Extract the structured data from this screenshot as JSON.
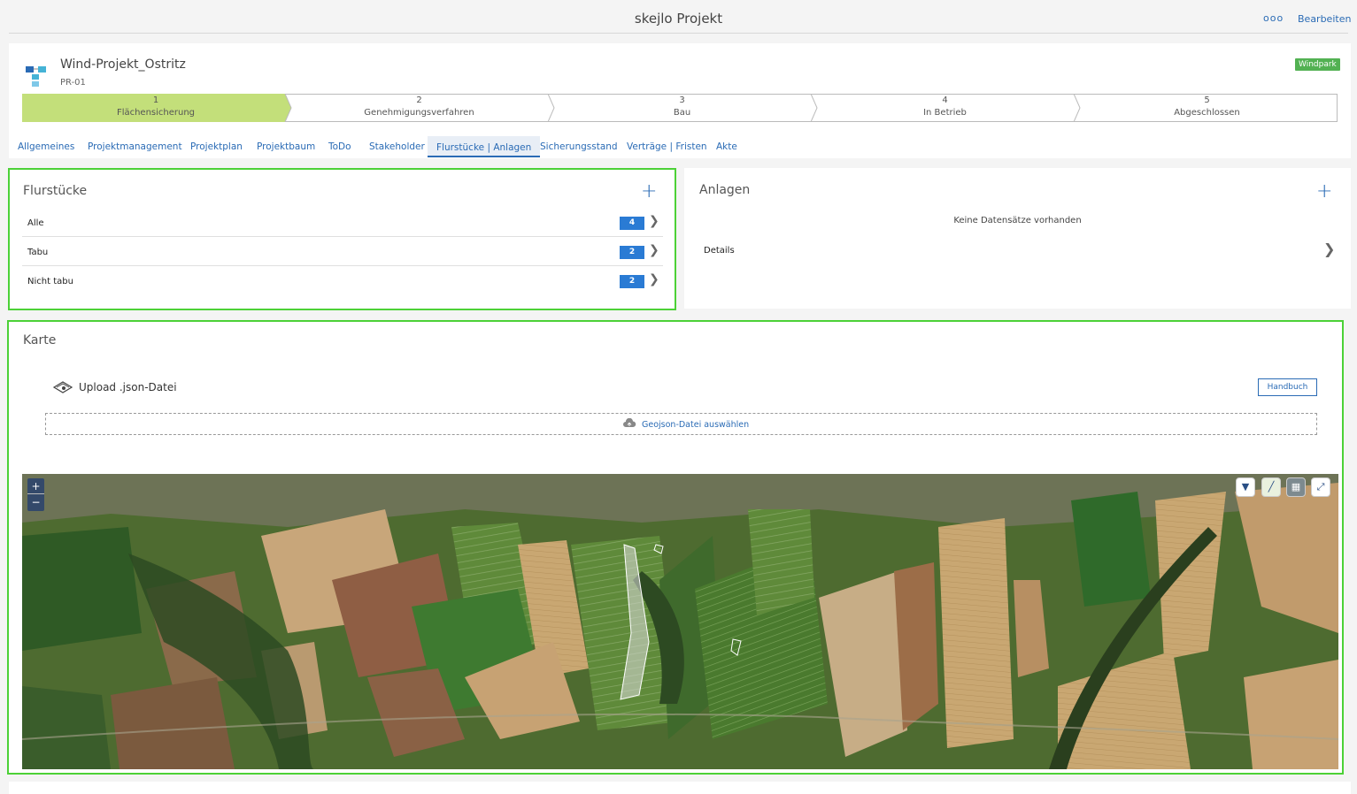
{
  "topbar": {
    "title": "skejlo Projekt",
    "more_label": "ooo",
    "edit_label": "Bearbeiten"
  },
  "project": {
    "name": "Wind-Projekt_Ostritz",
    "id": "PR-01",
    "badge": "Windpark",
    "badge_color": "#52b152"
  },
  "stepper": {
    "active_color": "#c3df7a",
    "steps": [
      {
        "num": "1",
        "label": "Flächensicherung"
      },
      {
        "num": "2",
        "label": "Genehmigungsverfahren"
      },
      {
        "num": "3",
        "label": "Bau"
      },
      {
        "num": "4",
        "label": "In Betrieb"
      },
      {
        "num": "5",
        "label": "Abgeschlossen"
      }
    ]
  },
  "tabs": [
    {
      "label": "Allgemeines"
    },
    {
      "label": "Projektmanagement"
    },
    {
      "label": "Projektplan"
    },
    {
      "label": "Projektbaum"
    },
    {
      "label": "ToDo"
    },
    {
      "label": "Stakeholder"
    },
    {
      "label": "Flurstücke | Anlagen",
      "active": true
    },
    {
      "label": "Sicherungsstand"
    },
    {
      "label": "Verträge | Fristen"
    },
    {
      "label": "Akte"
    }
  ],
  "flurstuecke": {
    "title": "Flurstücke",
    "rows": [
      {
        "label": "Alle",
        "count": "4"
      },
      {
        "label": "Tabu",
        "count": "2"
      },
      {
        "label": "Nicht tabu",
        "count": "2"
      }
    ]
  },
  "anlagen": {
    "title": "Anlagen",
    "empty": "Keine Datensätze vorhanden",
    "details": "Details"
  },
  "karte": {
    "title": "Karte",
    "upload_title": "Upload .json-Datei",
    "handbuch": "Handbuch",
    "dropzone_label": "Geojson-Datei auswählen",
    "zoom_in": "+",
    "zoom_out": "−"
  },
  "icons": [
    "logo-icon",
    "plus-icon",
    "chevron-right-icon",
    "upload-icon",
    "cloud-upload-icon",
    "filter-icon",
    "draw-icon",
    "layers-icon",
    "fullscreen-icon"
  ]
}
